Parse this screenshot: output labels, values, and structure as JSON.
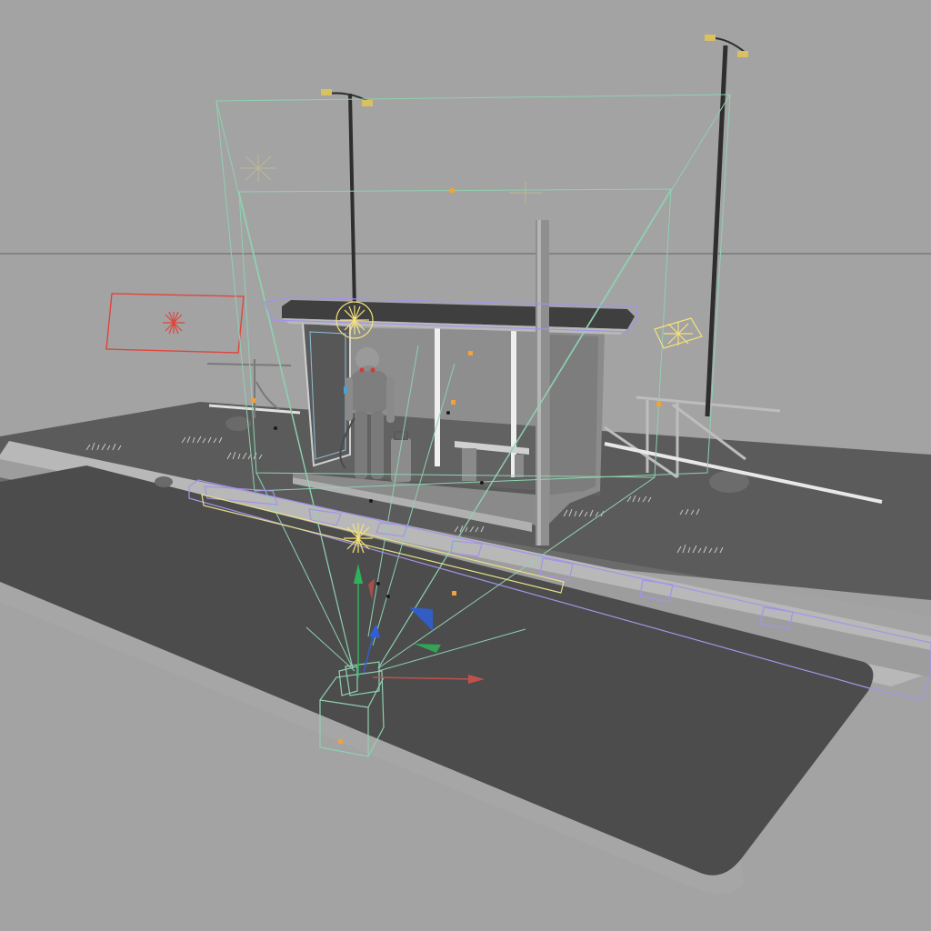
{
  "viewport": {
    "background_color": "#a3a3a3",
    "horizon_line_color": "#707070",
    "view_type": "perspective-3d-viewport"
  },
  "colors": {
    "ground_top": "#5e5e5e",
    "road_top": "#4a4a4a",
    "road_side": "#8e8e8e",
    "camera_frustum": "#8fd1b0",
    "selection_bbox": "#a493e8",
    "area_light": "#e0453a",
    "light_gizmo": "#f4e27a",
    "axis_x": "#d33a3a",
    "axis_y": "#2fb35a",
    "axis_z": "#2f5fd3",
    "pivot_point": "#f2a23a"
  },
  "scene": {
    "objects": [
      {
        "name": "bus-shelter",
        "kind": "mesh"
      },
      {
        "name": "astronaut-figure",
        "kind": "mesh"
      },
      {
        "name": "suitcase",
        "kind": "mesh"
      },
      {
        "name": "bench",
        "kind": "mesh"
      },
      {
        "name": "street-lamp-left",
        "kind": "mesh"
      },
      {
        "name": "street-lamp-right",
        "kind": "mesh"
      },
      {
        "name": "shelter-pole",
        "kind": "mesh"
      },
      {
        "name": "handrail",
        "kind": "mesh"
      },
      {
        "name": "road-slab",
        "kind": "mesh"
      },
      {
        "name": "curb",
        "kind": "mesh"
      },
      {
        "name": "grass-tufts",
        "kind": "mesh"
      },
      {
        "name": "camera",
        "kind": "camera"
      },
      {
        "name": "area-light",
        "kind": "light"
      },
      {
        "name": "point-light",
        "kind": "light"
      }
    ]
  }
}
